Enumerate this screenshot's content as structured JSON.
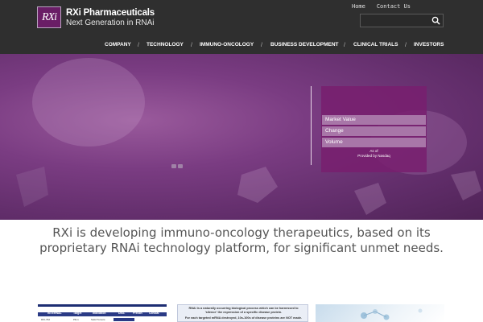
{
  "brand": {
    "logo_mark": "RXi",
    "name": "RXi Pharmaceuticals",
    "tagline": "Next Generation in RNAi"
  },
  "top_links": {
    "home": "Home",
    "contact": "Contact Us"
  },
  "search": {
    "placeholder": "",
    "icon": "search-icon"
  },
  "nav": {
    "items": [
      {
        "label": "COMPANY"
      },
      {
        "label": "TECHNOLOGY"
      },
      {
        "label": "IMMUNO-ONCOLOGY"
      },
      {
        "label": "BUSINESS DEVELOPMENT"
      },
      {
        "label": "CLINICAL TRIALS"
      },
      {
        "label": "INVESTORS"
      }
    ],
    "separator": "/"
  },
  "stock": {
    "rows": [
      {
        "label": "Market Value"
      },
      {
        "label": "Change"
      },
      {
        "label": "Volume"
      }
    ],
    "as_of": "As of",
    "provider": "Provided by Nasdaq"
  },
  "main": {
    "tagline": "RXi is developing immuno-oncology therapeutics, based on its proprietary RNAi technology platform, for significant unmet needs."
  },
  "thumbnails": {
    "pipeline": {
      "headers": [
        "INTERNAL",
        "Target",
        "Indication",
        "Disc.",
        "Preclin",
        "Clinical"
      ],
      "row": [
        "RXI-762",
        "PD-1",
        "Solid Tumors"
      ]
    },
    "rnai": {
      "line1": "RNAi is a naturally occurring biological process which can be harnessed to",
      "line2": "'silence' the expression of a specific disease protein.",
      "line3": "For each targeted mRNA destroyed, 10s-100s of disease proteins are NOT made."
    }
  },
  "colors": {
    "header_bg": "#2f2f2f",
    "brand_purple": "#6a1e66",
    "hero_purple": "#7a3c82",
    "stock_row": "#a876a8",
    "tagline_text": "#555555"
  }
}
